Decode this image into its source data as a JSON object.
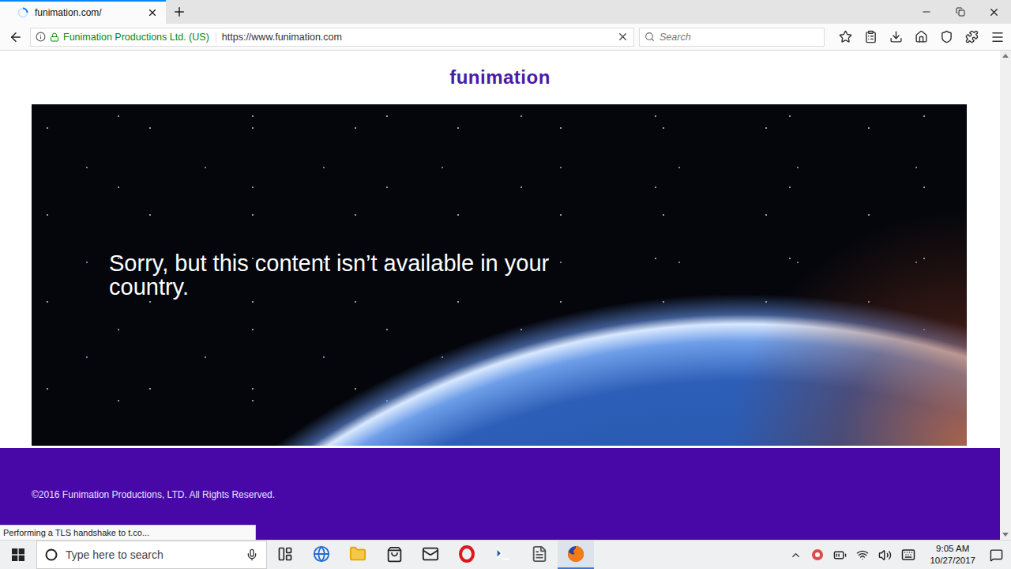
{
  "tabs": [
    {
      "label": "funimation.com/",
      "selected": true,
      "loading": true
    }
  ],
  "toolbar": {
    "identity": "Funimation Productions Ltd. (US)",
    "url": "https://www.funimation.com",
    "search_placeholder": "Search"
  },
  "page": {
    "logo": "funimation",
    "message": "Sorry, but this content isn’t available in your country.",
    "footer": "©2016 Funimation Productions, LTD. All Rights Reserved."
  },
  "status": "Performing a TLS handshake to t.co...",
  "taskbar": {
    "search_placeholder": "Type here to search",
    "apps": [
      {
        "kind": "task-view",
        "active": false
      },
      {
        "kind": "edge",
        "active": false
      },
      {
        "kind": "explorer",
        "active": false
      },
      {
        "kind": "store",
        "active": false
      },
      {
        "kind": "mail",
        "active": false
      },
      {
        "kind": "opera",
        "active": false
      },
      {
        "kind": "powershell",
        "active": false
      },
      {
        "kind": "files",
        "active": false
      },
      {
        "kind": "firefox",
        "active": true
      }
    ],
    "time": "9:05 AM",
    "date": "10/27/2017"
  }
}
